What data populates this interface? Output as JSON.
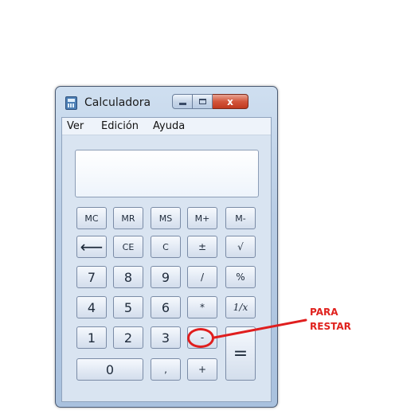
{
  "window": {
    "title": "Calculadora",
    "close_glyph": "x",
    "icon": "calculator-icon"
  },
  "menu": [
    "Ver",
    "Edición",
    "Ayuda"
  ],
  "display": {
    "value": ""
  },
  "buttons": {
    "mc": "MC",
    "mr": "MR",
    "ms": "MS",
    "mplus": "M+",
    "mminus": "M-",
    "back": "⟵",
    "ce": "CE",
    "c": "C",
    "plusminus": "±",
    "sqrt": "√",
    "d7": "7",
    "d8": "8",
    "d9": "9",
    "divide": "/",
    "percent": "%",
    "d4": "4",
    "d5": "5",
    "d6": "6",
    "multiply": "*",
    "reciprocal": "1/x",
    "d1": "1",
    "d2": "2",
    "d3": "3",
    "minus": "-",
    "equals": "=",
    "d0": "0",
    "comma": ",",
    "plus": "+"
  },
  "annotation": {
    "line1": "PARA",
    "line2": "RESTAR",
    "color": "#e0221e"
  }
}
